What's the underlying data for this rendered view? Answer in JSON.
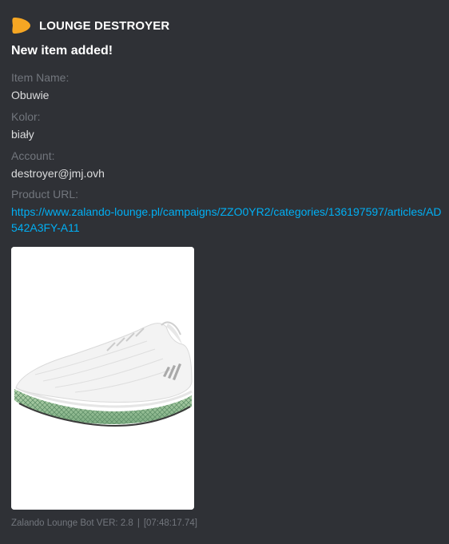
{
  "author": {
    "name": "LOUNGE DESTROYER",
    "icon": "orange-leaf-icon",
    "icon_color": "#f5a623"
  },
  "title": "New item added!",
  "fields": [
    {
      "name": "Item Name:",
      "value": "Obuwie"
    },
    {
      "name": "Kolor:",
      "value": "biały"
    },
    {
      "name": "Account:",
      "value": "destroyer@jmj.ovh"
    },
    {
      "name": "Product URL:",
      "value": "https://www.zalando-lounge.pl/campaigns/ZZO0YR2/categories/136197597/articles/AD542A3FY-A11"
    }
  ],
  "image": {
    "subject": "white-sneaker-image"
  },
  "footer": {
    "text": "Zalando Lounge Bot VER: 2.8",
    "separator": "|",
    "timestamp": "[07:48:17.74]"
  },
  "colors": {
    "background": "#2f3136",
    "link": "#00aff4",
    "muted": "#72767d",
    "text": "#dcddde"
  }
}
